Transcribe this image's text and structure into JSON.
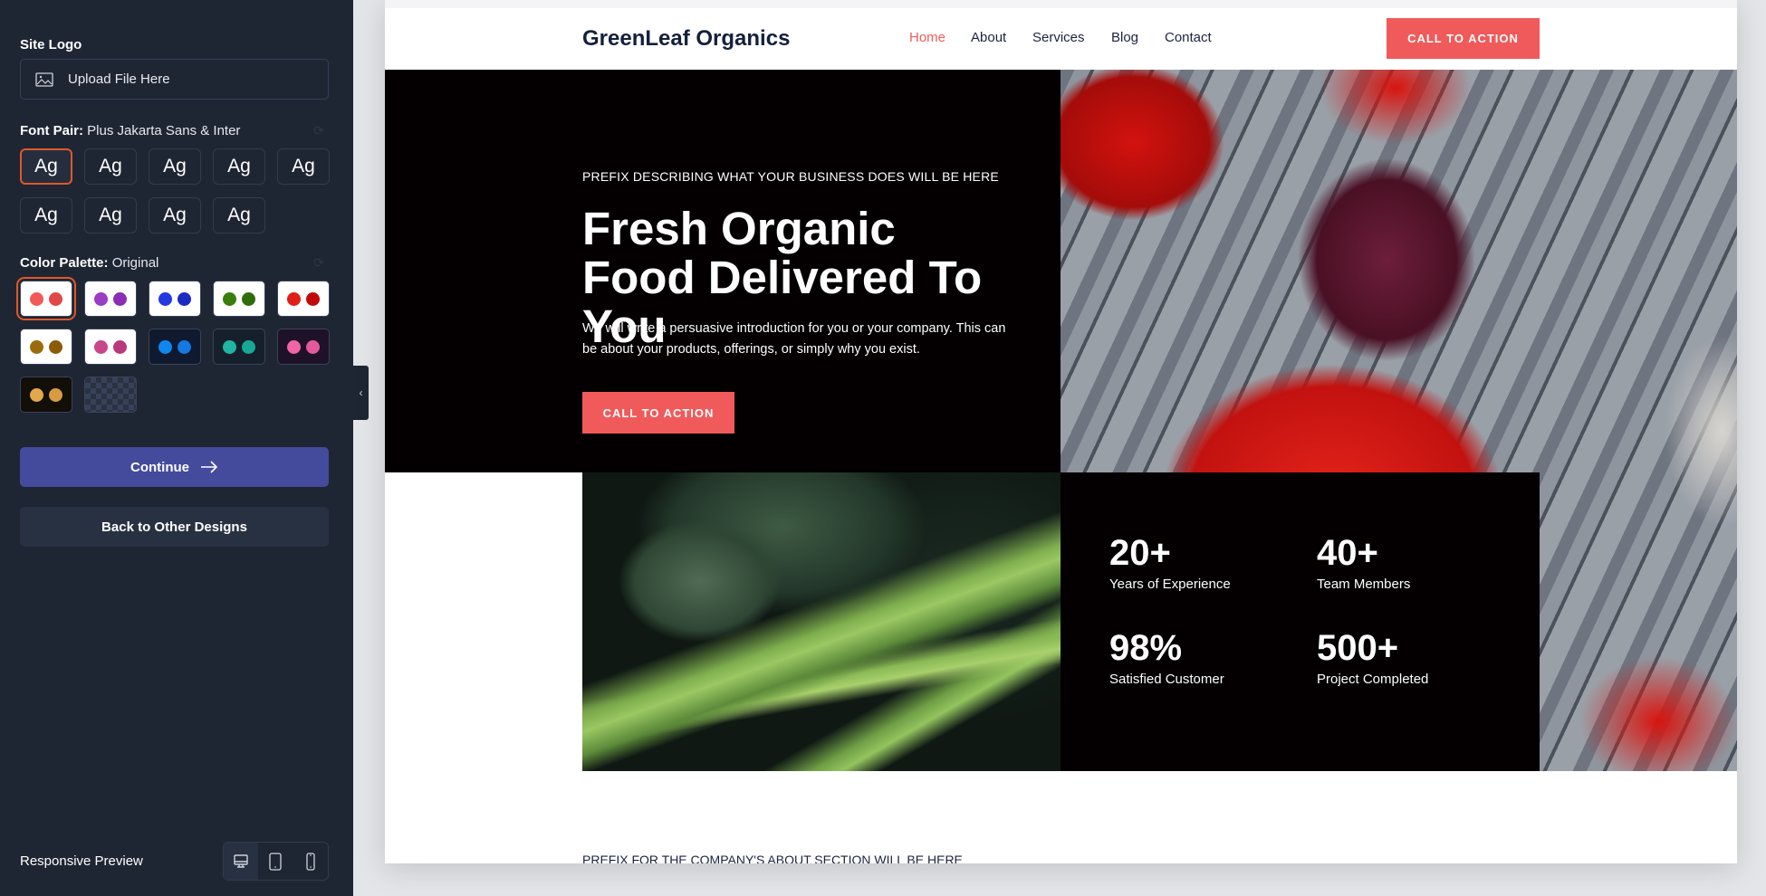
{
  "sidebar": {
    "site_logo_label": "Site Logo",
    "upload_label": "Upload File Here",
    "font_pair_label": "Font Pair:",
    "font_pair_value": "Plus Jakarta Sans & Inter",
    "font_samples": [
      "Ag",
      "Ag",
      "Ag",
      "Ag",
      "Ag",
      "Ag",
      "Ag",
      "Ag",
      "Ag"
    ],
    "color_palette_label": "Color Palette:",
    "color_palette_value": "Original",
    "palettes": [
      {
        "bg": "#ffffff",
        "c1": "#f05a5a",
        "c2": "#e04848"
      },
      {
        "bg": "#ffffff",
        "c1": "#9a3cc4",
        "c2": "#8a2eb5"
      },
      {
        "bg": "#ffffff",
        "c1": "#2338e0",
        "c2": "#1a2bc2"
      },
      {
        "bg": "#ffffff",
        "c1": "#3a7e0c",
        "c2": "#2f6d0a"
      },
      {
        "bg": "#ffffff",
        "c1": "#e01d16",
        "c2": "#c00a0a"
      },
      {
        "bg": "#ffffff",
        "c1": "#9a6b0c",
        "c2": "#8a5c08"
      },
      {
        "bg": "#ffffff",
        "c1": "#c8478a",
        "c2": "#b83a7c"
      },
      {
        "bg": "#0f1a30",
        "c1": "#0f86f0",
        "c2": "#1479e0"
      },
      {
        "bg": "#16202c",
        "c1": "#1fb5a2",
        "c2": "#18a894"
      },
      {
        "bg": "#1e1228",
        "c1": "#f064a8",
        "c2": "#e25a9c"
      },
      {
        "bg": "#120e08",
        "c1": "#e3a84a",
        "c2": "#d89c40"
      }
    ],
    "continue_label": "Continue",
    "back_label": "Back to Other Designs",
    "responsive_label": "Responsive Preview"
  },
  "preview": {
    "logo": "GreenLeaf Organics",
    "nav": [
      "Home",
      "About",
      "Services",
      "Blog",
      "Contact"
    ],
    "header_cta": "CALL TO ACTION",
    "hero_prefix": "PREFIX DESCRIBING WHAT YOUR BUSINESS DOES WILL BE HERE",
    "hero_title": "Fresh Organic Food Delivered To You",
    "hero_intro": "We will write a persuasive introduction for you or your company. This can be about your products, offerings, or simply why you exist.",
    "hero_cta": "CALL TO ACTION",
    "stats": [
      {
        "value": "20+",
        "label": "Years of Experience"
      },
      {
        "value": "40+",
        "label": "Team Members"
      },
      {
        "value": "98%",
        "label": "Satisfied Customer"
      },
      {
        "value": "500+",
        "label": "Project Completed"
      }
    ],
    "about_prefix": "PREFIX FOR THE COMPANY'S ABOUT SECTION WILL BE HERE"
  },
  "colors": {
    "accent": "#f05a5a",
    "sidebar_bg": "#1f2633",
    "continue_bg": "#444a9c",
    "selected_outline": "#e0572c"
  }
}
